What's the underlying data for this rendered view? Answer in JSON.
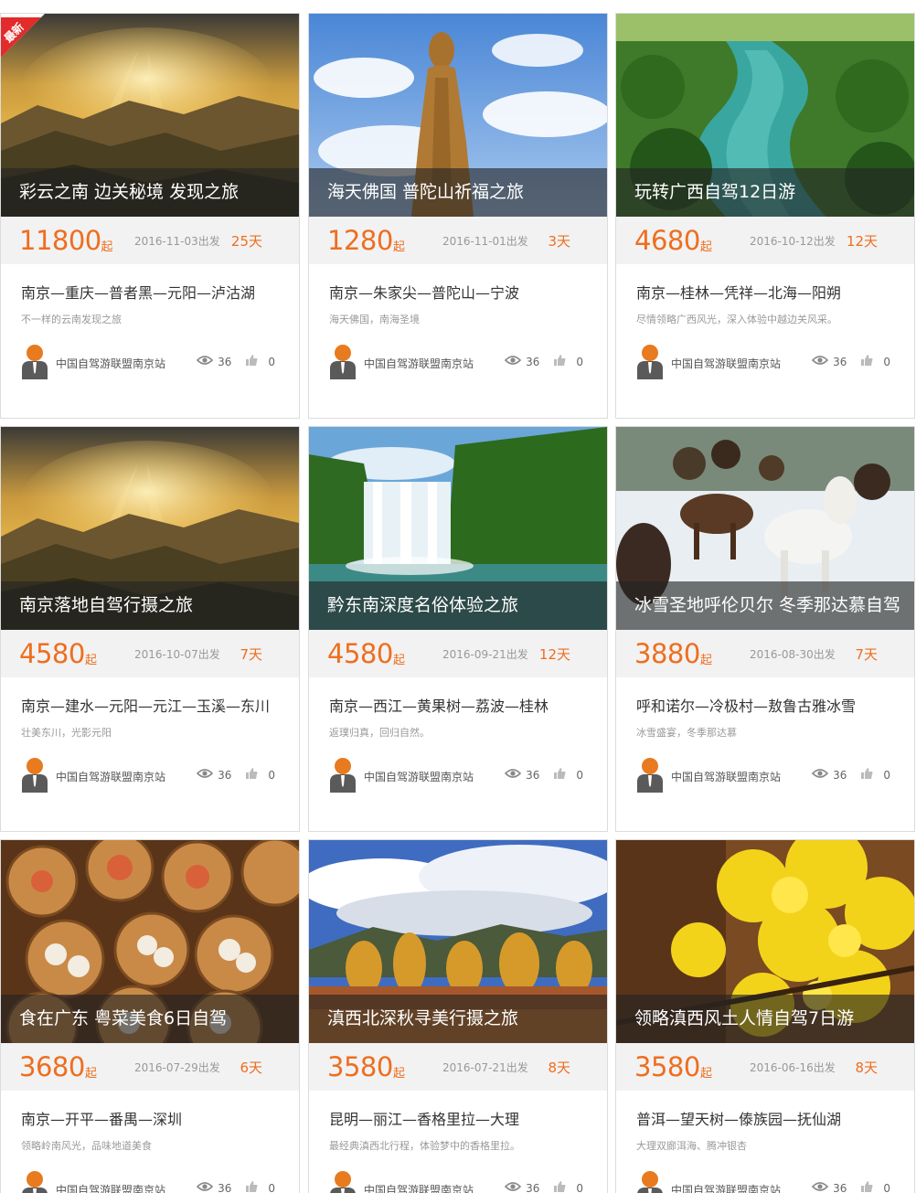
{
  "cards": [
    {
      "title": "彩云之南 边关秘境 发现之旅",
      "price": "11800",
      "suffix": "起",
      "date": "2016-11-03出发",
      "days": "25天",
      "route": "南京—重庆—普者黑—元阳—泸沽湖",
      "tagline": "不一样的云南发现之旅",
      "org": "中国自驾游联盟南京站",
      "views": "36",
      "likes": "0",
      "badge": "最新",
      "scene": "sunset-mountains"
    },
    {
      "title": "海天佛国 普陀山祈福之旅",
      "price": "1280",
      "suffix": "起",
      "date": "2016-11-01出发",
      "days": "3天",
      "route": "南京—朱家尖—普陀山—宁波",
      "tagline": "海天佛国，南海圣境",
      "org": "中国自驾游联盟南京站",
      "views": "36",
      "likes": "0",
      "scene": "statue"
    },
    {
      "title": "玩转广西自驾12日游",
      "price": "4680",
      "suffix": "起",
      "date": "2016-10-12出发",
      "days": "12天",
      "route": "南京—桂林—凭祥—北海—阳朔",
      "tagline": "尽情领略广西风光，深入体验中越边关风采。",
      "org": "中国自驾游联盟南京站",
      "views": "36",
      "likes": "0",
      "scene": "river"
    },
    {
      "title": "南京落地自驾行摄之旅",
      "price": "4580",
      "suffix": "起",
      "date": "2016-10-07出发",
      "days": "7天",
      "route": "南京—建水—元阳—元江—玉溪—东川",
      "tagline": "壮美东川，光影元阳",
      "org": "中国自驾游联盟南京站",
      "views": "36",
      "likes": "0",
      "scene": "sunset-mountains"
    },
    {
      "title": "黔东南深度名俗体验之旅",
      "price": "4580",
      "suffix": "起",
      "date": "2016-09-21出发",
      "days": "12天",
      "route": "南京—西江—黄果树—荔波—桂林",
      "tagline": "返璞归真，回归自然。",
      "org": "中国自驾游联盟南京站",
      "views": "36",
      "likes": "0",
      "scene": "waterfall"
    },
    {
      "title": "冰雪圣地呼伦贝尔 冬季那达慕自驾",
      "price": "3880",
      "suffix": "起",
      "date": "2016-08-30出发",
      "days": "7天",
      "route": "呼和诺尔—冷极村—敖鲁古雅冰雪",
      "tagline": "冰雪盛宴，冬季那达慕",
      "org": "中国自驾游联盟南京站",
      "views": "36",
      "likes": "0",
      "scene": "horses"
    },
    {
      "title": "食在广东 粤菜美食6日自驾",
      "price": "3680",
      "suffix": "起",
      "date": "2016-07-29出发",
      "days": "6天",
      "route": "南京—开平—番禺—深圳",
      "tagline": "领略岭南风光，品味地道美食",
      "org": "中国自驾游联盟南京站",
      "views": "36",
      "likes": "0",
      "scene": "dimsum"
    },
    {
      "title": "滇西北深秋寻美行摄之旅",
      "price": "3580",
      "suffix": "起",
      "date": "2016-07-21出发",
      "days": "8天",
      "route": "昆明—丽江—香格里拉—大理",
      "tagline": "最经典滇西北行程，体验梦中的香格里拉。",
      "org": "中国自驾游联盟南京站",
      "views": "36",
      "likes": "0",
      "scene": "autumn"
    },
    {
      "title": "领略滇西风土人情自驾7日游",
      "price": "3580",
      "suffix": "起",
      "date": "2016-06-16出发",
      "days": "8天",
      "route": "普洱—望天树—傣族园—抚仙湖",
      "tagline": "大理双廊洱海、腾冲银杏",
      "org": "中国自驾游联盟南京站",
      "views": "36",
      "likes": "0",
      "scene": "ginkgo"
    }
  ]
}
